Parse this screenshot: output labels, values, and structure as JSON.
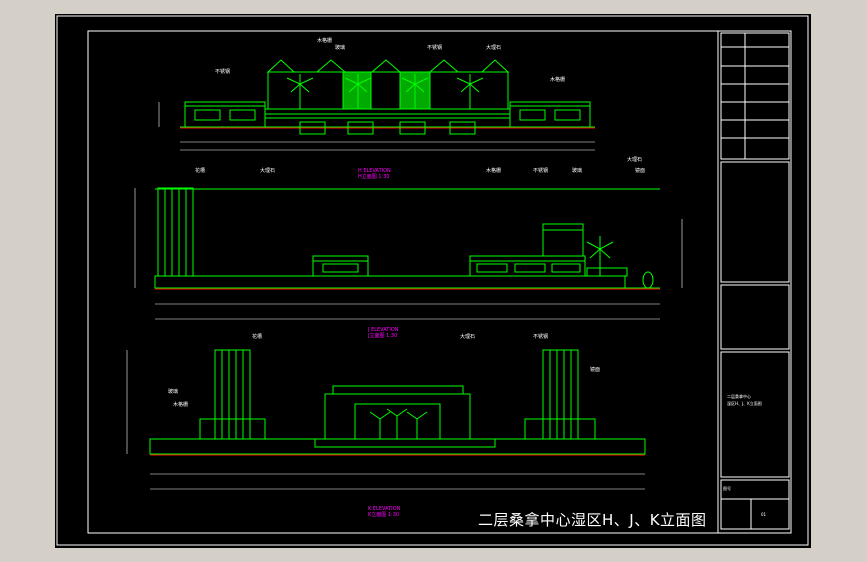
{
  "drawing_caption": "二层桑拿中心湿区H、J、K立面图",
  "views": {
    "h": {
      "title_top": "H ELEVATION",
      "title_bottom": "H立面图 1:30"
    },
    "j": {
      "title_top": "J ELEVATION",
      "title_bottom": "J立面图 1:30"
    },
    "k": {
      "title_top": "K ELEVATION",
      "title_bottom": "K立面图 1:30"
    }
  },
  "notes": {
    "wood_grille": "木格栅",
    "stainless_steel": "不锈钢",
    "glass": "玻璃",
    "marble": "大理石",
    "planter": "花槽",
    "mirror": "镜面"
  },
  "title_block": {
    "project": "二层桑拿中心",
    "sheet_name": "湿区H、J、K立面图",
    "label": "图号",
    "sheet_no": "01"
  },
  "colors": {
    "sheet_bg": "#000000",
    "window_bg": "#d4d0c8",
    "frame": "#ffffff",
    "geometry": "#00ff00",
    "annotation": "#ffffff",
    "title": "#ff00ff",
    "floor": "#ff0000"
  }
}
